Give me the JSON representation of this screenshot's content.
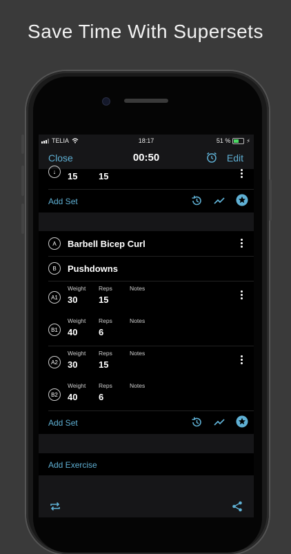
{
  "headline": "Save Time With Supersets",
  "status": {
    "carrier": "TELIA",
    "time": "18:17",
    "battery": "51 %"
  },
  "nav": {
    "close": "Close",
    "timer": "00:50",
    "edit": "Edit"
  },
  "top_set": {
    "badge": "↓",
    "weight": "15",
    "reps": "15"
  },
  "add_set_1": "Add Set",
  "superset": {
    "a_badge": "A",
    "a_name": "Barbell Bicep Curl",
    "b_badge": "B",
    "b_name": "Pushdowns",
    "headers": {
      "weight": "Weight",
      "reps": "Reps",
      "notes": "Notes"
    },
    "sets": [
      {
        "badge": "A1",
        "weight": "30",
        "reps": "15"
      },
      {
        "badge": "B1",
        "weight": "40",
        "reps": "6"
      },
      {
        "badge": "A2",
        "weight": "30",
        "reps": "15"
      },
      {
        "badge": "B2",
        "weight": "40",
        "reps": "6"
      }
    ]
  },
  "add_set_2": "Add Set",
  "add_exercise": "Add Exercise",
  "colors": {
    "accent": "#5fb0d4",
    "background": "#000000",
    "bar": "#161618"
  },
  "icons": [
    "history-icon",
    "trend-icon",
    "star-icon",
    "repeat-icon",
    "share-icon",
    "alarm-icon"
  ]
}
